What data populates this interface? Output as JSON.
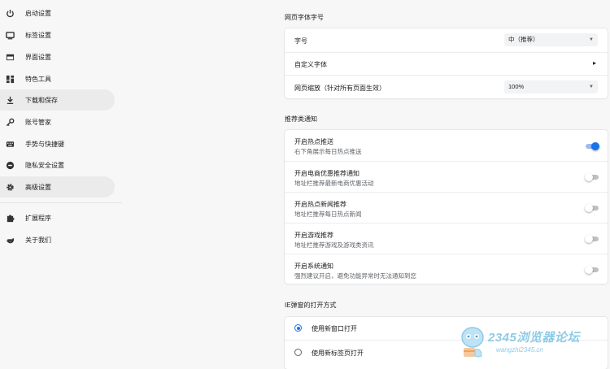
{
  "sidebar": {
    "items": [
      {
        "label": "启动设置",
        "icon": "power-icon"
      },
      {
        "label": "标签设置",
        "icon": "tab-icon"
      },
      {
        "label": "界面设置",
        "icon": "window-icon"
      },
      {
        "label": "特色工具",
        "icon": "dashboard-icon"
      },
      {
        "label": "下载和保存",
        "icon": "download-icon",
        "active": true
      },
      {
        "label": "账号管家",
        "icon": "key-icon"
      },
      {
        "label": "手势与快捷键",
        "icon": "keyboard-icon"
      },
      {
        "label": "隐私安全设置",
        "icon": "shield-icon"
      },
      {
        "label": "高级设置",
        "icon": "gear-icon",
        "active": true
      },
      {
        "label": "扩展程序",
        "icon": "puzzle-icon"
      },
      {
        "label": "关于我们",
        "icon": "browser-logo-icon"
      }
    ]
  },
  "font_section": {
    "title": "网页字体字号",
    "size_label": "字号",
    "size_value": "中（推荐）",
    "custom_font_label": "自定义字体",
    "zoom_label": "网页缩放（针对所有页面生效）",
    "zoom_value": "100%"
  },
  "notify_section": {
    "title": "推荐类通知",
    "items": [
      {
        "label": "开启热点推送",
        "sub": "右下角展示每日热点推送",
        "on": true
      },
      {
        "label": "开启电商优惠推荐通知",
        "sub": "地址栏推荐最新电商优惠活动",
        "on": false
      },
      {
        "label": "开启热点新闻推荐",
        "sub": "地址栏推荐每日热点新闻",
        "on": false
      },
      {
        "label": "开启游戏推荐",
        "sub": "地址栏推荐游戏及游戏类资讯",
        "on": false
      },
      {
        "label": "开启系统通知",
        "sub": "强烈建议开启，避免功能异常时无法通知到您",
        "on": false
      }
    ]
  },
  "popup_section": {
    "title": "IE弹窗的打开方式",
    "options": [
      {
        "label": "使用新窗口打开",
        "checked": true
      },
      {
        "label": "使用新标签页打开",
        "checked": false
      }
    ]
  },
  "watermark": {
    "text": "2345浏览器论坛",
    "url": "wangzhi2345.cn"
  },
  "colors": {
    "accent": "#1a73e8",
    "active_bg": "#ebebeb",
    "page_bg": "#f7f7f7"
  }
}
